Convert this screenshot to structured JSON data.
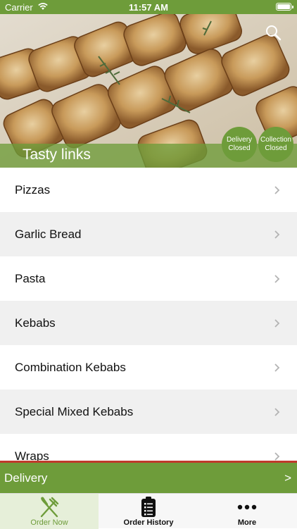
{
  "status_bar": {
    "carrier": "Carrier",
    "time": "11:57 AM",
    "icons": [
      "wifi-icon",
      "battery-icon"
    ]
  },
  "header": {
    "title": "Tasty links",
    "search_icon": "search-icon",
    "delivery_status": {
      "line1": "Delivery",
      "line2": "Closed"
    },
    "collection_status": {
      "line1": "Collection",
      "line2": "Closed"
    }
  },
  "menu": {
    "items": [
      {
        "label": "Pizzas"
      },
      {
        "label": "Garlic Bread"
      },
      {
        "label": "Pasta"
      },
      {
        "label": "Kebabs"
      },
      {
        "label": "Combination Kebabs"
      },
      {
        "label": "Special Mixed Kebabs"
      },
      {
        "label": "Wraps"
      }
    ]
  },
  "delivery_bar": {
    "label": "Delivery",
    "arrow": ">"
  },
  "tab_bar": {
    "tabs": [
      {
        "label": "Order Now",
        "icon": "fork-knife-icon"
      },
      {
        "label": "Order History",
        "icon": "clipboard-icon"
      },
      {
        "label": "More",
        "icon": "more-dots-icon"
      }
    ]
  },
  "colors": {
    "brand_green": "#6e9c3a",
    "accent_red": "#c0392b"
  }
}
